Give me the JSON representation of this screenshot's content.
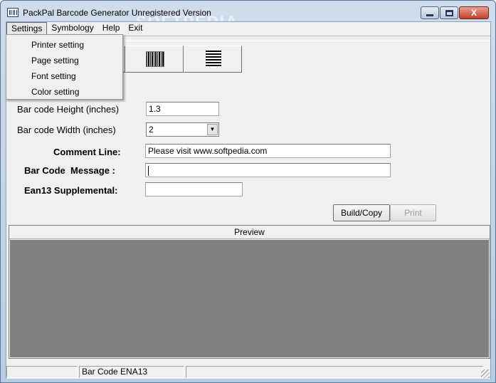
{
  "window": {
    "title": "PackPal Barcode Generator Unregistered Version",
    "close_glyph": "X"
  },
  "menu": {
    "items": [
      "Settings",
      "Symbology",
      "Help",
      "Exit"
    ],
    "open_menu": "Settings",
    "settings_items": [
      "Printer setting",
      "Page setting",
      "Font setting",
      "Color setting"
    ]
  },
  "toolbar": {
    "buttons": [
      {
        "icon": "printer-icon"
      },
      {
        "icon": "color-palette-icon"
      },
      {
        "icon": "barcode-icon"
      },
      {
        "icon": "stacked-barcode-icon"
      }
    ]
  },
  "form": {
    "height_label": "Bar code Height (inches)",
    "height_value": "1.3",
    "width_label": "Bar code Width (inches)",
    "width_value": "2",
    "comment_label": "Comment Line:",
    "comment_value": "Please visit www.softpedia.com",
    "message_label": "Bar Code  Message :",
    "message_value": "",
    "supplemental_label": "Ean13 Supplemental:",
    "supplemental_value": ""
  },
  "actions": {
    "build_label": "Build/Copy",
    "print_label": "Print"
  },
  "preview": {
    "header": "Preview"
  },
  "status": {
    "pane1": "",
    "pane2": "Bar Code ENA13",
    "pane3": ""
  },
  "watermark": "SOFTPEDIA",
  "colors": {
    "preview_bg": "#808080",
    "titlebar": "#b9cce2"
  }
}
